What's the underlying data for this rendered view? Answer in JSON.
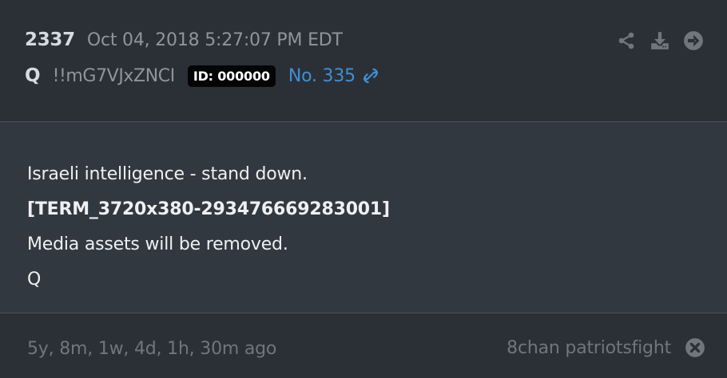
{
  "post": {
    "number": "2337",
    "timestamp": "Oct 04, 2018 5:27:07 PM EDT",
    "author": "Q",
    "tripcode": "!!mG7VJxZNCI",
    "id_badge": "ID: 000000",
    "post_no": "No. 335"
  },
  "actions": [
    {
      "icon": "share-icon"
    },
    {
      "icon": "download-icon"
    },
    {
      "icon": "arrow-right-circle-icon"
    }
  ],
  "content": {
    "lines": [
      "Israeli intelligence - stand down.",
      "[TERM_3720x380-293476669283001]",
      "Media assets will be removed.",
      "Q"
    ]
  },
  "footer": {
    "relative_time": "5y, 8m, 1w, 4d, 1h, 30m ago",
    "source": "8chan patriotsfight"
  },
  "colors": {
    "background": "#2b3036",
    "body_background": "#313840",
    "link": "#3f8fd5",
    "muted": "#8f959b",
    "badge": "#050505"
  }
}
